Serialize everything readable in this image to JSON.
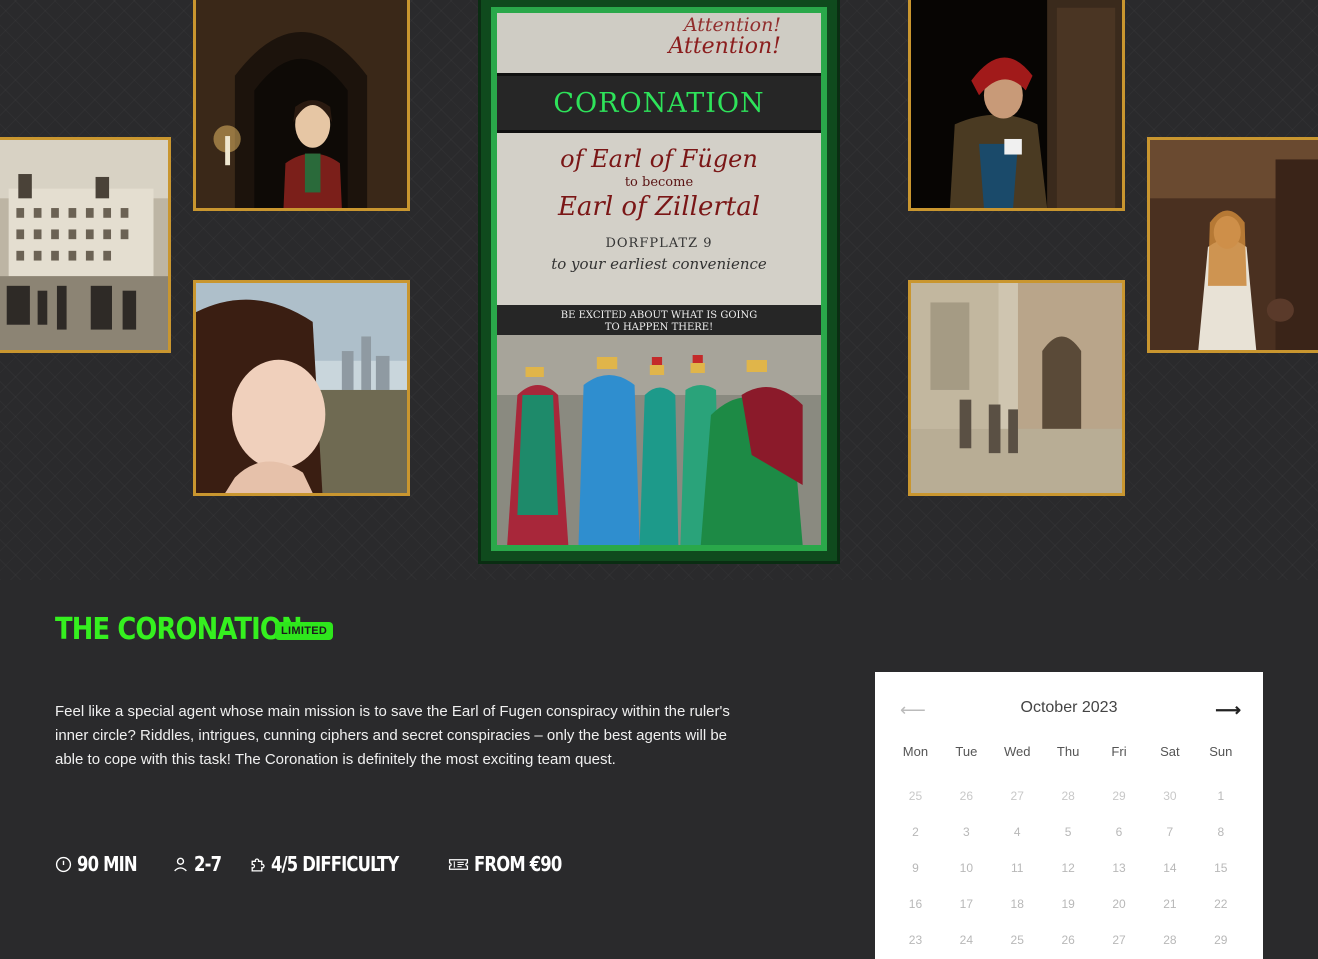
{
  "poster": {
    "attention_1": "Attention!",
    "attention_2": "Attention!",
    "band": "CORONATION",
    "line1": "of Earl of Fügen",
    "line2": "to become",
    "line3": "Earl of Zillertal",
    "line4": "DORFPLATZ 9",
    "line5": "to your earliest convenience",
    "strip_1": "BE EXCITED ABOUT WHAT IS GOING",
    "strip_2": "TO HAPPEN THERE!"
  },
  "quest": {
    "title": "THE CORONATION",
    "badge": "LIMITED",
    "description": "Feel like a special agent whose main mission is to save the Earl of Fugen conspiracy within the ruler's inner circle? Riddles, intrigues, cunning ciphers and secret conspiracies – only the best agents will be able to cope with this task! The Coronation is definitely the most exciting team quest."
  },
  "stats": [
    {
      "icon": "clock-icon",
      "text": "90 MIN"
    },
    {
      "icon": "person-icon",
      "text": "2-7"
    },
    {
      "icon": "puzzle-icon",
      "text": "4/5 DIFFICULTY"
    },
    {
      "icon": "ticket-icon",
      "text": "FROM €90"
    }
  ],
  "calendar": {
    "month": "October 2023",
    "prev": "⟵",
    "next": "⟶",
    "weekdays": [
      "Mon",
      "Tue",
      "Wed",
      "Thu",
      "Fri",
      "Sat",
      "Sun"
    ],
    "weeks": [
      [
        "25",
        "26",
        "27",
        "28",
        "29",
        "30",
        "1"
      ],
      [
        "2",
        "3",
        "4",
        "5",
        "6",
        "7",
        "8"
      ],
      [
        "9",
        "10",
        "11",
        "12",
        "13",
        "14",
        "15"
      ],
      [
        "16",
        "17",
        "18",
        "19",
        "20",
        "21",
        "22"
      ],
      [
        "23",
        "24",
        "25",
        "26",
        "27",
        "28",
        "29"
      ]
    ]
  },
  "colors": {
    "accent": "#35f01f",
    "frame": "#c9962f",
    "background": "#2a2a2c"
  }
}
